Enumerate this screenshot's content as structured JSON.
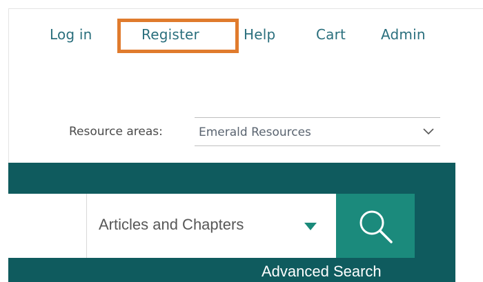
{
  "nav": {
    "login": "Log in",
    "register": "Register",
    "help": "Help",
    "cart": "Cart",
    "admin": "Admin"
  },
  "resource_areas": {
    "label": "Resource areas:",
    "selected": "Emerald Resources"
  },
  "search": {
    "query": "",
    "content_type": "Articles and Chapters",
    "advanced_link": "Advanced Search"
  },
  "colors": {
    "band": "#0f5b5e",
    "search_button": "#1b8a7c",
    "link": "#2a6f7d",
    "highlight": "#e07b2d"
  },
  "icons": {
    "search_button": "search-icon",
    "resource_dropdown": "chevron-down-icon",
    "type_dropdown": "caret-down-icon"
  }
}
